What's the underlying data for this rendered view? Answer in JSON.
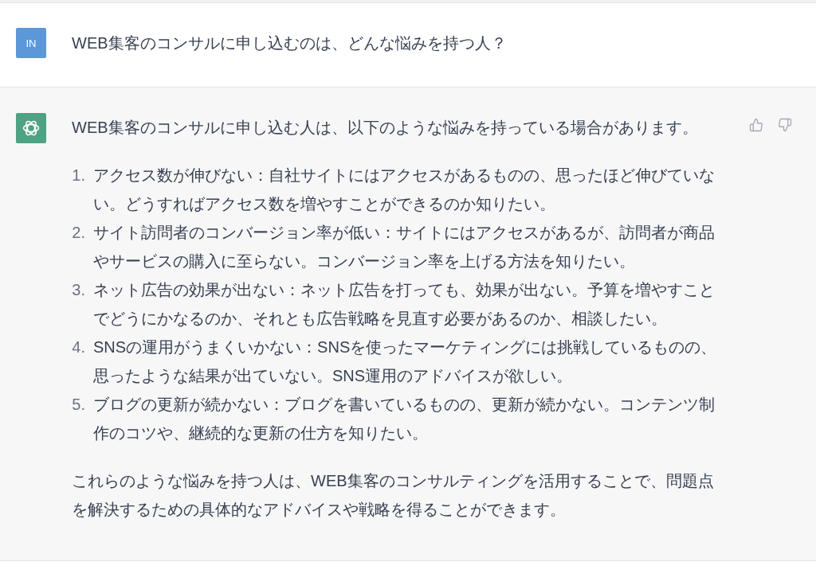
{
  "user_message": {
    "avatar": "IN",
    "text": "WEB集客のコンサルに申し込むのは、どんな悩みを持つ人？"
  },
  "assistant_message": {
    "intro": "WEB集客のコンサルに申し込む人は、以下のような悩みを持っている場合があります。",
    "items": [
      {
        "number": "1.",
        "text": "アクセス数が伸びない：自社サイトにはアクセスがあるものの、思ったほど伸びていない。どうすればアクセス数を増やすことができるのか知りたい。"
      },
      {
        "number": "2.",
        "text": "サイト訪問者のコンバージョン率が低い：サイトにはアクセスがあるが、訪問者が商品やサービスの購入に至らない。コンバージョン率を上げる方法を知りたい。"
      },
      {
        "number": "3.",
        "text": "ネット広告の効果が出ない：ネット広告を打っても、効果が出ない。予算を増やすことでどうにかなるのか、それとも広告戦略を見直す必要があるのか、相談したい。"
      },
      {
        "number": "4.",
        "text": "SNSの運用がうまくいかない：SNSを使ったマーケティングには挑戦しているものの、思ったような結果が出ていない。SNS運用のアドバイスが欲しい。"
      },
      {
        "number": "5.",
        "text": "ブログの更新が続かない：ブログを書いているものの、更新が続かない。コンテンツ制作のコツや、継続的な更新の仕方を知りたい。"
      }
    ],
    "closing": "これらのような悩みを持つ人は、WEB集客のコンサルティングを活用することで、問題点を解決するための具体的なアドバイスや戦略を得ることができます。"
  }
}
